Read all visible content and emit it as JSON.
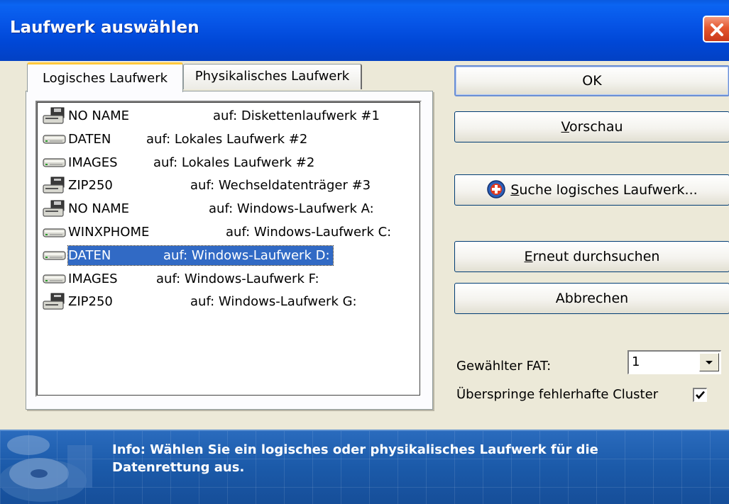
{
  "window": {
    "title": "Laufwerk auswählen"
  },
  "tabs": [
    {
      "label": "Logisches Laufwerk",
      "selected": true
    },
    {
      "label": "Physikalisches Laufwerk",
      "selected": false
    }
  ],
  "drives": [
    {
      "name": "NO NAME",
      "location": "auf: Diskettenlaufwerk #1",
      "icon": "floppy-drive-icon",
      "selected": false
    },
    {
      "name": "DATEN",
      "location": "auf: Lokales Laufwerk #2",
      "icon": "hard-drive-icon",
      "selected": false
    },
    {
      "name": "IMAGES",
      "location": "auf: Lokales Laufwerk #2",
      "icon": "hard-drive-icon",
      "selected": false
    },
    {
      "name": "ZIP250",
      "location": "auf: Wechseldatenträger #3",
      "icon": "removable-drive-icon",
      "selected": false
    },
    {
      "name": "NO NAME",
      "location": "auf: Windows-Laufwerk A:",
      "icon": "floppy-drive-icon",
      "selected": false
    },
    {
      "name": "WINXPHOME",
      "location": "auf: Windows-Laufwerk C:",
      "icon": "hard-drive-icon",
      "selected": false
    },
    {
      "name": "DATEN",
      "location": "auf: Windows-Laufwerk D:",
      "icon": "hard-drive-icon",
      "selected": true
    },
    {
      "name": "IMAGES",
      "location": "auf: Windows-Laufwerk F:",
      "icon": "hard-drive-icon",
      "selected": false
    },
    {
      "name": "ZIP250",
      "location": "auf: Windows-Laufwerk G:",
      "icon": "removable-drive-icon",
      "selected": false
    }
  ],
  "buttons": {
    "ok": "OK",
    "preview_mnemonic": "V",
    "preview_rest": "orschau",
    "search_mnemonic": "S",
    "search_rest": "uche logisches Laufwerk...",
    "rescan_mnemonic": "E",
    "rescan_rest": "rneut durchsuchen",
    "cancel": "Abbrechen"
  },
  "fat": {
    "label": "Gewählter FAT:",
    "value": "1"
  },
  "skip_bad_clusters": {
    "label": "Überspringe fehlerhafte Cluster",
    "checked": true
  },
  "info": {
    "line1": "Info: Wählen Sie ein logisches oder physikalisches Laufwerk für die",
    "line2": "Datenrettung aus."
  },
  "colors": {
    "titlebar": "#0054E3",
    "selection": "#316AC5",
    "infobar": "#1E5AA8",
    "close": "#E4572F"
  }
}
